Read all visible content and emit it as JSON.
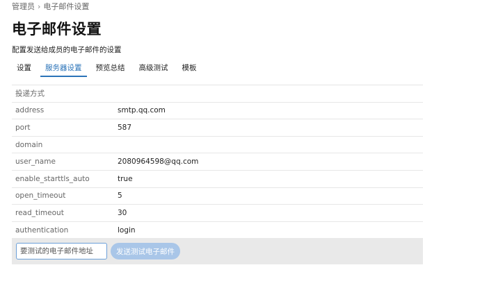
{
  "breadcrumb": {
    "root": "管理员",
    "separator": "›",
    "current": "电子邮件设置"
  },
  "header": {
    "title": "电子邮件设置",
    "description": "配置发送给成员的电子邮件的设置"
  },
  "tabs": [
    {
      "label": "设置",
      "active": false
    },
    {
      "label": "服务器设置",
      "active": true
    },
    {
      "label": "预览总结",
      "active": false
    },
    {
      "label": "高级测试",
      "active": false
    },
    {
      "label": "模板",
      "active": false
    }
  ],
  "settings": {
    "section_label": "投递方式",
    "rows": [
      {
        "key": "address",
        "value": "smtp.qq.com"
      },
      {
        "key": "port",
        "value": "587"
      },
      {
        "key": "domain",
        "value": ""
      },
      {
        "key": "user_name",
        "value": "2080964598@qq.com"
      },
      {
        "key": "enable_starttls_auto",
        "value": "true"
      },
      {
        "key": "open_timeout",
        "value": "5"
      },
      {
        "key": "read_timeout",
        "value": "30"
      },
      {
        "key": "authentication",
        "value": "login"
      }
    ]
  },
  "test_email": {
    "placeholder": "要测试的电子邮件地址",
    "value": "",
    "button_label": "发送测试电子邮件"
  },
  "colors": {
    "accent": "#2a73b8",
    "button_disabled": "#a9c6e8",
    "action_bar": "#e9e9e9"
  }
}
